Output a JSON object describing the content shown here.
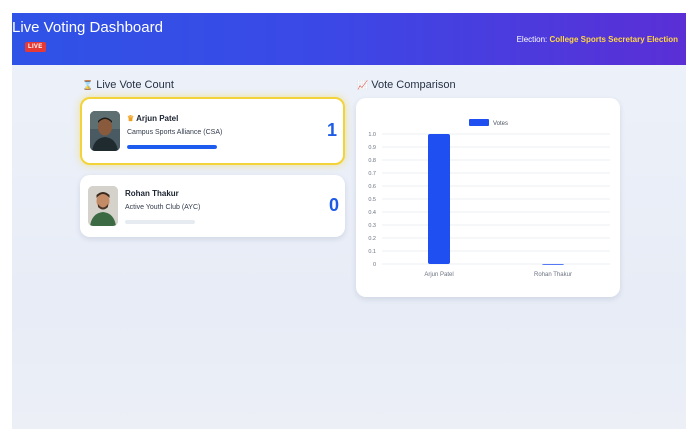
{
  "header": {
    "title": "Live Voting Dashboard",
    "live_badge": "LIVE",
    "election_label": "Election:",
    "election_name": "College Sports Secretary Election"
  },
  "sections": {
    "vote_count": {
      "icon": "hourglass-icon",
      "title": "Live Vote Count"
    },
    "comparison": {
      "icon": "chart-icon",
      "title": "Vote Comparison"
    }
  },
  "candidates": [
    {
      "name": "Arjun Patel",
      "party": "Campus Sports Alliance (CSA)",
      "votes": "1",
      "leader_icon": "crown-icon",
      "progress": 1.0
    },
    {
      "name": "Rohan Thakur",
      "party": "Active Youth Club (AYC)",
      "votes": "0",
      "progress": 0.0
    }
  ],
  "colors": {
    "accent": "#1e5ce6",
    "leader_border": "#f2d43a",
    "live": "#e53935",
    "election_name": "#ffd740"
  },
  "chart_data": {
    "type": "bar",
    "categories": [
      "Arjun Patel",
      "Rohan Thakur"
    ],
    "series": [
      {
        "name": "Votes",
        "values": [
          1,
          0
        ]
      }
    ],
    "ylim": [
      0,
      1.0
    ],
    "yticks": [
      "0",
      "0.1",
      "0.2",
      "0.3",
      "0.4",
      "0.5",
      "0.6",
      "0.7",
      "0.8",
      "0.9",
      "1.0"
    ],
    "legend": "top",
    "grid": true
  }
}
